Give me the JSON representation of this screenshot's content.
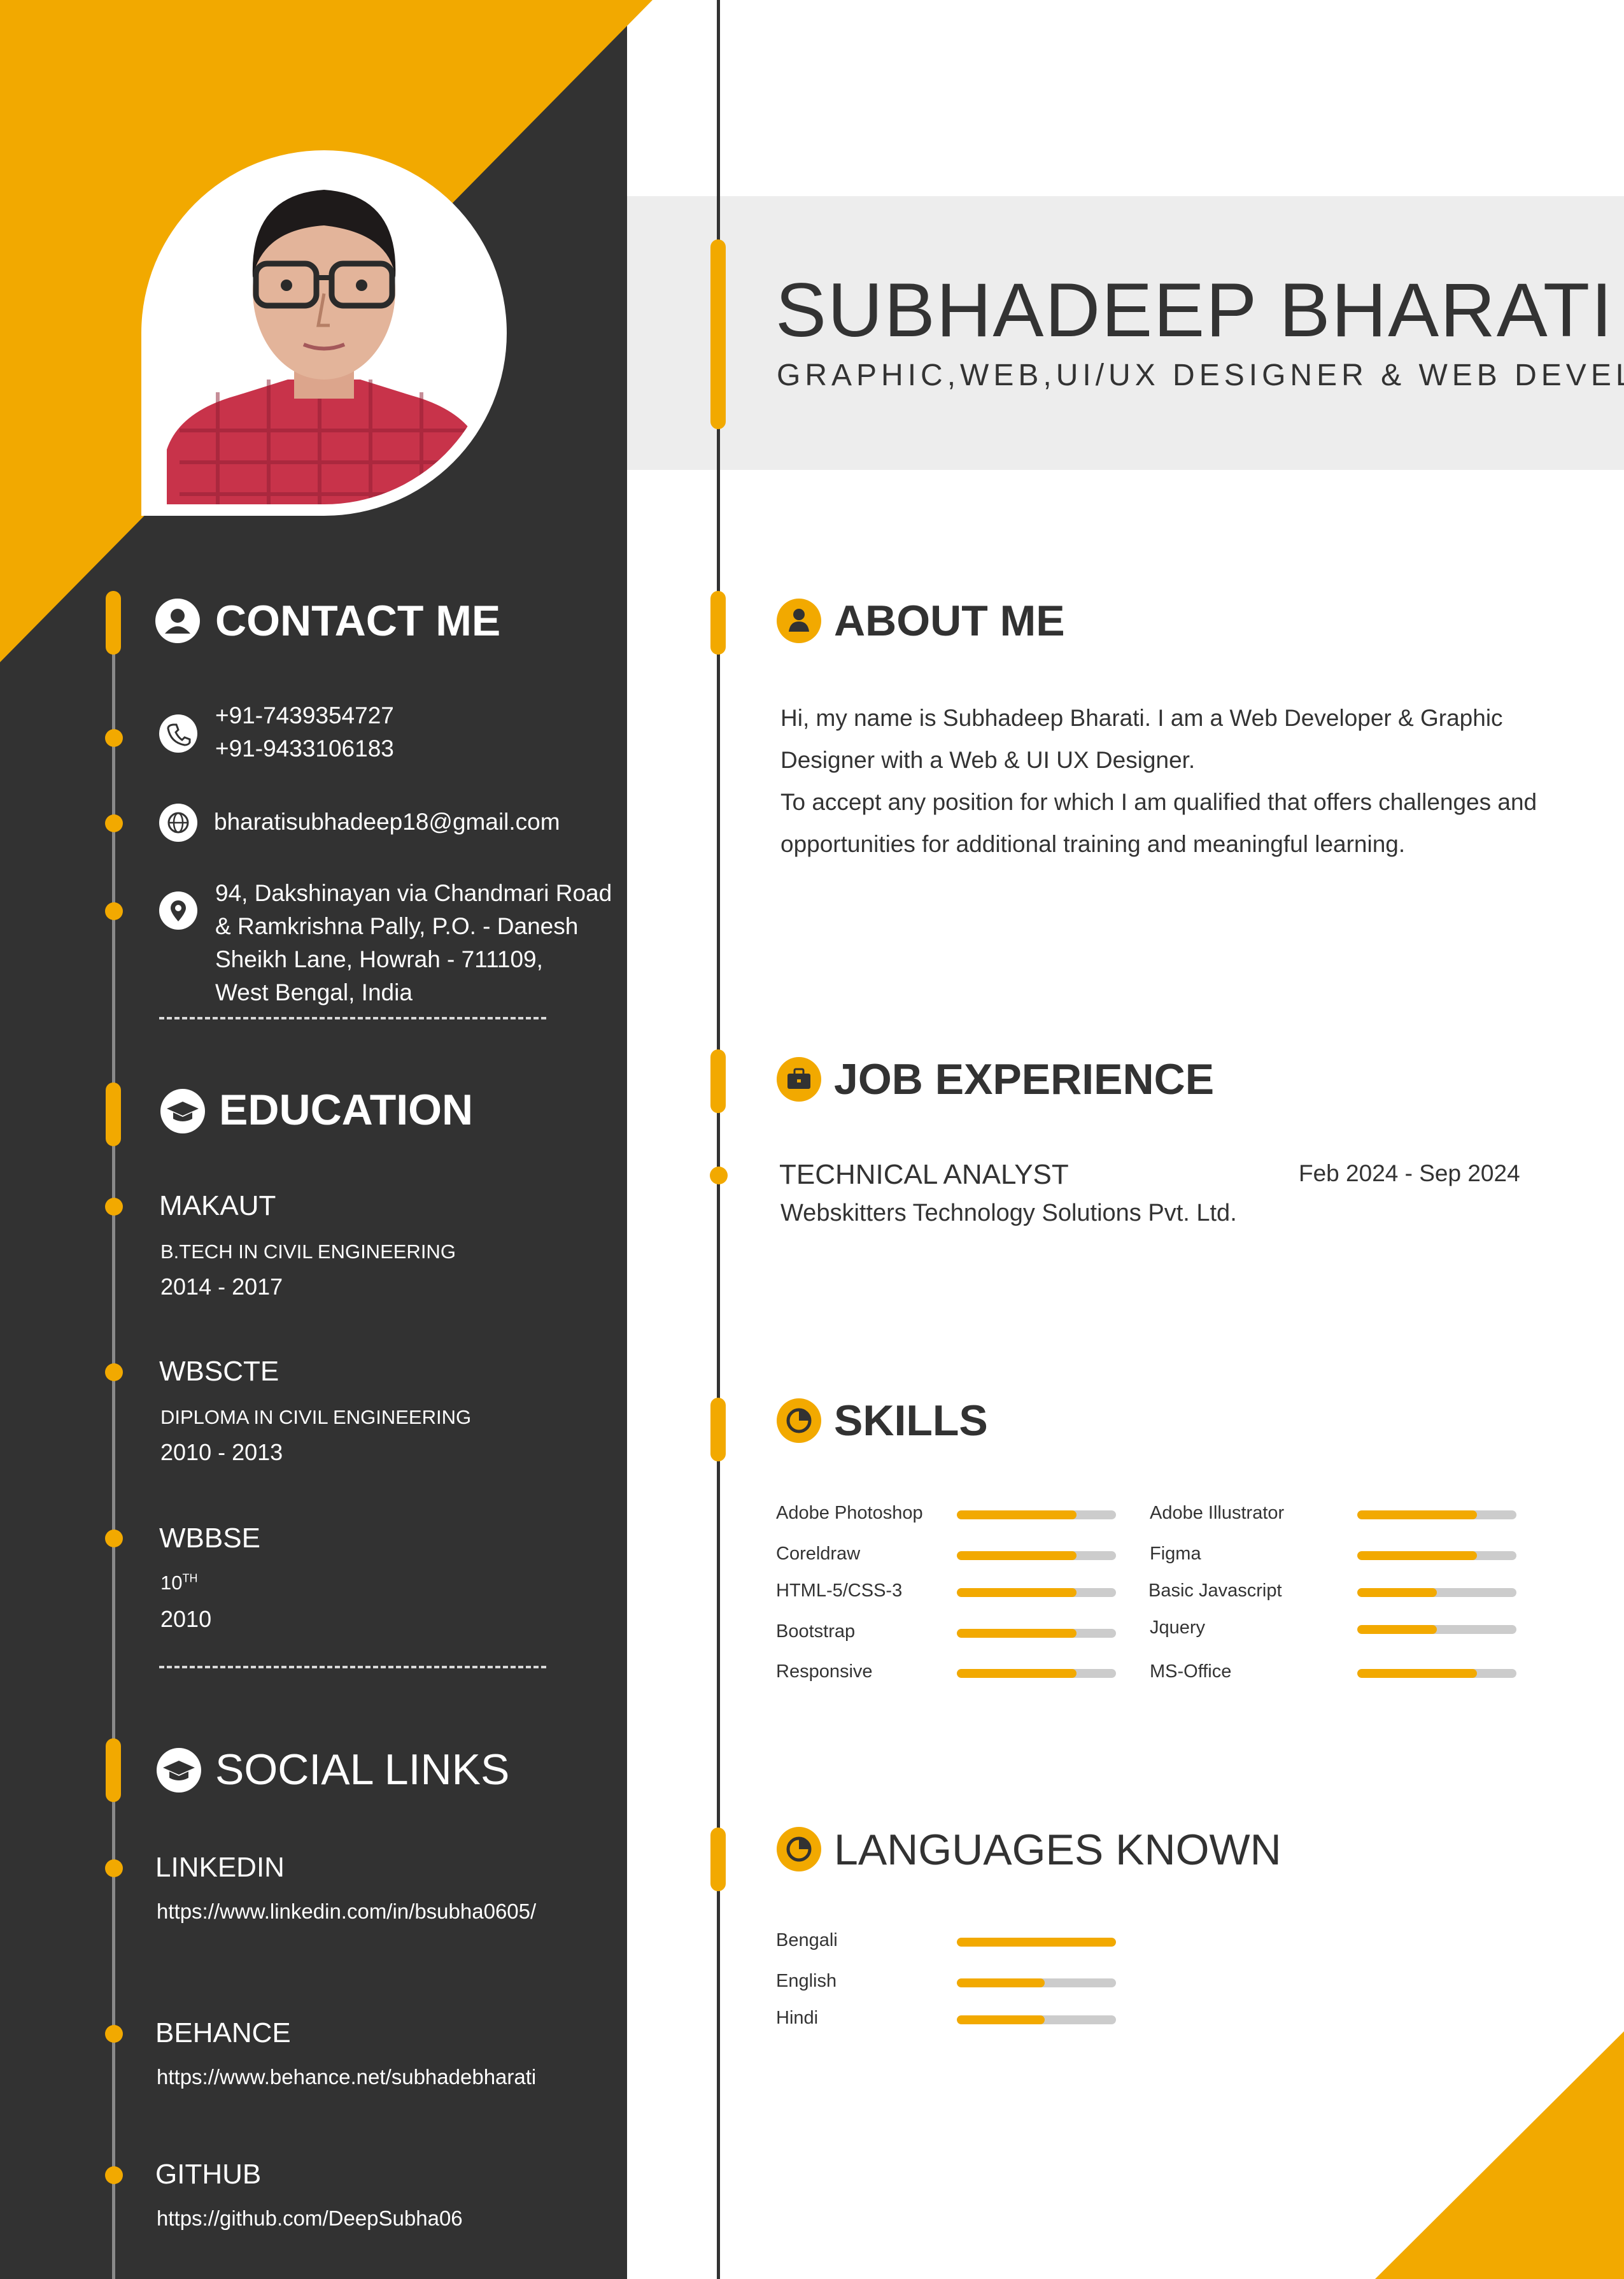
{
  "colors": {
    "accent": "#f2a900",
    "dark": "#323232",
    "band": "#ededed",
    "track": "#cccccc"
  },
  "header": {
    "name": "SUBHADEEP BHARATI",
    "title": "GRAPHIC,WEB,UI/UX DESIGNER & WEB DEVELOPER"
  },
  "contact": {
    "heading": "CONTACT ME",
    "heading_icon": "user-icon",
    "phones": [
      "+91-7439354727",
      "+91-9433106183"
    ],
    "phone_icon": "phone-icon",
    "email": "bharatisubhadeep18@gmail.com",
    "email_icon": "globe-icon",
    "address": [
      "94, Dakshinayan via Chandmari Road",
      "& Ramkrishna Pally, P.O. - Danesh",
      "Sheikh Lane, Howrah - 711109,",
      "West Bengal, India"
    ],
    "address_icon": "location-pin-icon"
  },
  "education": {
    "heading": "EDUCATION",
    "heading_icon": "graduation-cap-icon",
    "items": [
      {
        "institution": "MAKAUT",
        "degree": "B.TECH IN CIVIL ENGINEERING",
        "years": "2014 - 2017"
      },
      {
        "institution": "WBSCTE",
        "degree": "DIPLOMA IN CIVIL ENGINEERING",
        "years": "2010 - 2013"
      },
      {
        "institution": "WBBSE",
        "degree": "10",
        "degree_sup": "TH",
        "years": "2010"
      }
    ]
  },
  "social": {
    "heading": "SOCIAL LINKS",
    "heading_icon": "graduation-cap-icon",
    "items": [
      {
        "name": "LINKEDIN",
        "url": "https://www.linkedin.com/in/bsubha0605/"
      },
      {
        "name": "BEHANCE",
        "url": "https://www.behance.net/subhadebharati"
      },
      {
        "name": "GITHUB",
        "url": "https://github.com/DeepSubha06"
      }
    ]
  },
  "about": {
    "heading": "ABOUT ME",
    "heading_icon": "person-icon",
    "paragraphs": [
      "Hi, my name is Subhadeep Bharati. I am a Web Developer & Graphic Designer with a Web & UI UX Designer.",
      "To accept any position for which I am qualified that offers challenges and opportunities for additional training and meaningful learning."
    ]
  },
  "experience": {
    "heading": "JOB EXPERIENCE",
    "heading_icon": "briefcase-icon",
    "items": [
      {
        "role": "TECHNICAL ANALYST",
        "dates": "Feb 2024 - Sep 2024",
        "company": "Webskitters Technology Solutions Pvt. Ltd."
      }
    ]
  },
  "skills": {
    "heading": "SKILLS",
    "heading_icon": "pie-chart-icon",
    "left": [
      {
        "name": "Adobe Photoshop",
        "level": 0.75
      },
      {
        "name": "Coreldraw",
        "level": 0.75
      },
      {
        "name": "HTML-5/CSS-3",
        "level": 0.75
      },
      {
        "name": "Bootstrap",
        "level": 0.75
      },
      {
        "name": "Responsive",
        "level": 0.75
      }
    ],
    "right": [
      {
        "name": "Adobe Illustrator",
        "level": 0.75
      },
      {
        "name": "Figma",
        "level": 0.75
      },
      {
        "name": "Basic Javascript",
        "level": 0.5
      },
      {
        "name": "Jquery",
        "level": 0.5
      },
      {
        "name": "MS-Office",
        "level": 0.75
      }
    ]
  },
  "languages": {
    "heading": "LANGUAGES KNOWN",
    "heading_icon": "pie-chart-icon",
    "items": [
      {
        "name": "Bengali",
        "level": 1.0
      },
      {
        "name": "English",
        "level": 0.55
      },
      {
        "name": "Hindi",
        "level": 0.55
      }
    ]
  }
}
